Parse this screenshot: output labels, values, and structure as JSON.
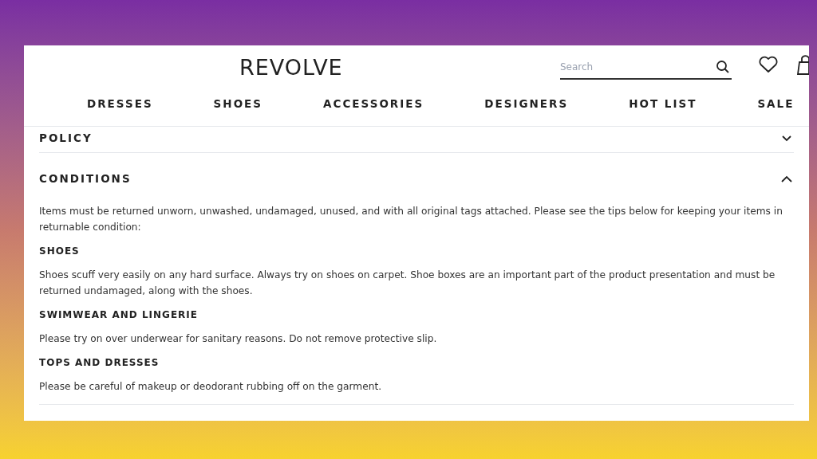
{
  "header": {
    "logo": "REVOLVE",
    "search": {
      "placeholder": "Search"
    }
  },
  "nav": [
    "DRESSES",
    "SHOES",
    "ACCESSORIES",
    "DESIGNERS",
    "HOT LIST",
    "SALE"
  ],
  "sections": [
    {
      "title": "POLICY",
      "expanded": false
    },
    {
      "title": "CONDITIONS",
      "expanded": true,
      "content": [
        {
          "kind": "paragraph",
          "text": "Items must be returned unworn, unwashed, undamaged, unused, and with all original tags attached. Please see the tips below for keeping your items in returnable condition:"
        },
        {
          "kind": "heading",
          "text": "SHOES"
        },
        {
          "kind": "paragraph",
          "text": "Shoes scuff very easily on any hard surface. Always try on shoes on carpet. Shoe boxes are an important part of the product presentation and must be returned undamaged, along with the shoes."
        },
        {
          "kind": "heading",
          "text": "SWIMWEAR AND LINGERIE"
        },
        {
          "kind": "paragraph",
          "text": "Please try on over underwear for sanitary reasons. Do not remove protective slip."
        },
        {
          "kind": "heading",
          "text": "TOPS AND DRESSES"
        },
        {
          "kind": "paragraph",
          "text": "Please be careful of makeup or deodorant rubbing off on the garment."
        }
      ]
    }
  ]
}
